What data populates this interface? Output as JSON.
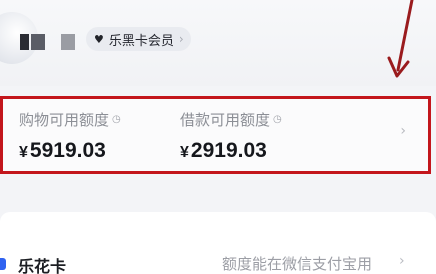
{
  "header": {
    "vip_badge_label": "乐黑卡会员",
    "heart_icon": "♥",
    "chevron_icon": "›"
  },
  "quota_card": {
    "shopping": {
      "label": "购物可用额度",
      "currency": "¥",
      "amount": "5919.03"
    },
    "loan": {
      "label": "借款可用额度",
      "currency": "¥",
      "amount": "2919.03"
    },
    "clock_icon": "◷",
    "chevron_icon": "›"
  },
  "lehua_row": {
    "title": "乐花卡",
    "description": "额度能在微信支付宝用",
    "chevron_icon": "›"
  },
  "colors": {
    "highlight_border": "#c3161c",
    "annotation_arrow": "#9a1b1e",
    "brand_blue": "#2f62f0"
  }
}
